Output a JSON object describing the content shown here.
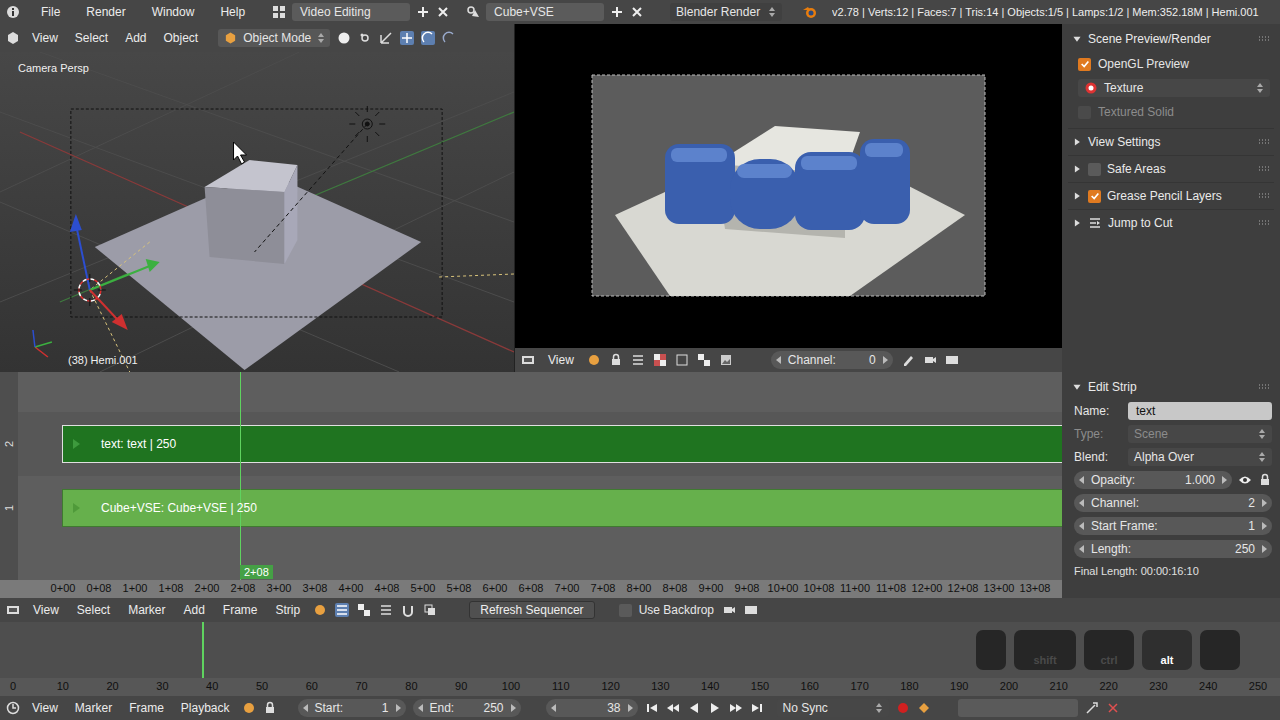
{
  "info_bar": {
    "menus": [
      "File",
      "Render",
      "Window",
      "Help"
    ],
    "layout": "Video Editing",
    "scene": "Cube+VSE",
    "engine": "Blender Render",
    "stats": "v2.78 | Verts:12 | Faces:7 | Tris:14 | Objects:1/5 | Lamps:1/2 | Mem:352.18M | Hemi.001"
  },
  "view3d": {
    "menus": [
      "View",
      "Select",
      "Add",
      "Object"
    ],
    "mode": "Object Mode",
    "view_label": "Camera Persp",
    "status": "(38) Hemi.001"
  },
  "preview": {
    "menus": [
      "View"
    ],
    "channel_label": "Channel:",
    "channel": "0"
  },
  "preview_panel": {
    "title": "Scene Preview/Render",
    "expanded": true,
    "items": [
      {
        "kind": "checkbox",
        "label": "OpenGL Preview",
        "checked": true,
        "disabled": false
      },
      {
        "kind": "dropdown",
        "label": "Texture",
        "disabled": false
      },
      {
        "kind": "checkbox",
        "label": "Textured Solid",
        "checked": false,
        "disabled": true
      }
    ],
    "subpanels": [
      {
        "kind": "plain",
        "label": "View Settings",
        "expanded": false
      },
      {
        "kind": "checkbox",
        "label": "Safe Areas",
        "expanded": false,
        "checked": false
      },
      {
        "kind": "checkbox",
        "label": "Grease Pencil Layers",
        "expanded": false,
        "checked": true
      },
      {
        "kind": "icon",
        "label": "Jump to Cut",
        "expanded": false
      }
    ]
  },
  "sequencer": {
    "channels": [
      {
        "number": "2",
        "strip": {
          "label": "text: text | 250",
          "selected": true
        }
      },
      {
        "number": "1",
        "strip": {
          "label": "Cube+VSE: Cube+VSE | 250",
          "selected": false
        }
      }
    ],
    "playhead": {
      "label": "2+08",
      "level": 0.226
    },
    "ruler": [
      "0+00",
      "0+08",
      "1+00",
      "1+08",
      "2+00",
      "2+08",
      "3+00",
      "3+08",
      "4+00",
      "4+08",
      "5+00",
      "5+08",
      "6+00",
      "6+08",
      "7+00",
      "7+08",
      "8+00",
      "8+08",
      "9+00",
      "9+08",
      "10+00",
      "10+08",
      "11+00",
      "11+08",
      "12+00",
      "12+08",
      "13+00",
      "13+08"
    ]
  },
  "edit_strip": {
    "title": "Edit Strip",
    "expanded": true,
    "fields": [
      {
        "kind": "text",
        "label": "Name:",
        "value": "text",
        "disabled": false
      },
      {
        "kind": "dropdown",
        "label": "Type:",
        "value": "Scene",
        "disabled": true
      },
      {
        "kind": "dropdown",
        "label": "Blend:",
        "value": "Alpha Over",
        "disabled": false
      },
      {
        "kind": "keyed-number",
        "label": "Opacity:",
        "value": "1.000",
        "disabled": false
      },
      {
        "kind": "number",
        "label": "Channel:",
        "value": "2",
        "disabled": false
      },
      {
        "kind": "number",
        "label": "Start Frame:",
        "value": "1",
        "disabled": false
      },
      {
        "kind": "number",
        "label": "Length:",
        "value": "250",
        "disabled": false
      }
    ],
    "footer": "Final Length: 00:00:16:10"
  },
  "seq_header": {
    "menus": [
      "View",
      "Select",
      "Marker",
      "Add",
      "Frame",
      "Strip"
    ],
    "refresh": "Refresh Sequencer",
    "backdrop": {
      "label": "Use Backdrop",
      "checked": false
    }
  },
  "timeline": {
    "ruler": [
      "0",
      "10",
      "20",
      "30",
      "40",
      "50",
      "60",
      "70",
      "80",
      "90",
      "100",
      "110",
      "120",
      "130",
      "140",
      "150",
      "160",
      "170",
      "180",
      "190",
      "200",
      "210",
      "220",
      "230",
      "240",
      "250"
    ],
    "playhead": {
      "level": 0.152
    },
    "keys": [
      {
        "label": "",
        "pressed": false
      },
      {
        "label": "shift",
        "pressed": false
      },
      {
        "label": "ctrl",
        "pressed": false
      },
      {
        "label": "alt",
        "pressed": true
      },
      {
        "label": "",
        "pressed": false
      }
    ]
  },
  "timeline_header": {
    "menus": [
      "View",
      "Marker",
      "Frame",
      "Playback"
    ],
    "start": {
      "label": "Start:",
      "value": "1"
    },
    "end": {
      "label": "End:",
      "value": "250"
    },
    "current": "38",
    "sync": "No Sync"
  }
}
